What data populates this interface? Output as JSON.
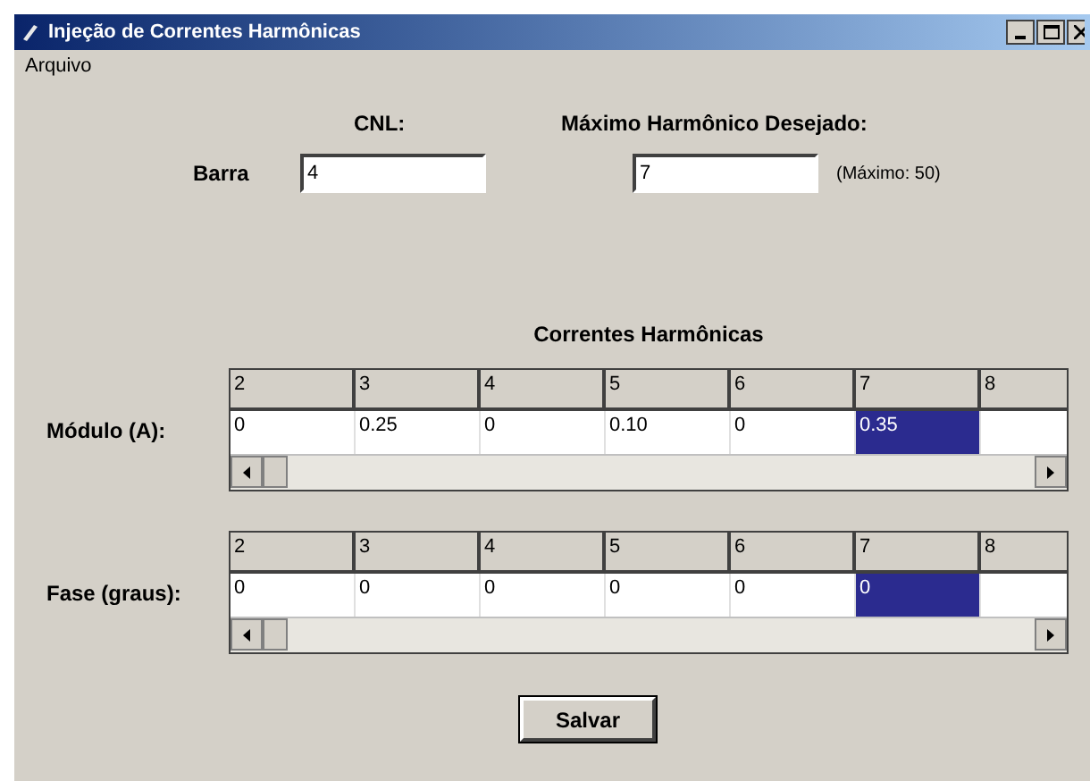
{
  "window": {
    "title": "Injeção de Correntes Harmônicas"
  },
  "menu": [
    {
      "label": "Arquivo"
    }
  ],
  "cnl": {
    "heading": "CNL:",
    "label": "Barra",
    "value": "4"
  },
  "max_harmonic": {
    "heading": "Máximo Harmônico Desejado:",
    "value": "7",
    "hint": "(Máximo: 50)"
  },
  "section_title": "Correntes Harmônicas",
  "tables": [
    {
      "label": "Módulo (A):",
      "columns": [
        "2",
        "3",
        "4",
        "5",
        "6",
        "7",
        "8"
      ],
      "cells": [
        {
          "text": "0",
          "selected": false
        },
        {
          "text": "0.25",
          "selected": false
        },
        {
          "text": "0",
          "selected": false
        },
        {
          "text": "0.10",
          "selected": false
        },
        {
          "text": "0",
          "selected": false
        },
        {
          "text": "0.35",
          "selected": true
        }
      ]
    },
    {
      "label": "Fase (graus):",
      "columns": [
        "2",
        "3",
        "4",
        "5",
        "6",
        "7",
        "8"
      ],
      "cells": [
        {
          "text": "0",
          "selected": false
        },
        {
          "text": "0",
          "selected": false
        },
        {
          "text": "0",
          "selected": false
        },
        {
          "text": "0",
          "selected": false
        },
        {
          "text": "0",
          "selected": false
        },
        {
          "text": "0",
          "selected": true
        }
      ]
    }
  ],
  "buttons": [
    {
      "label": "Salvar"
    }
  ]
}
